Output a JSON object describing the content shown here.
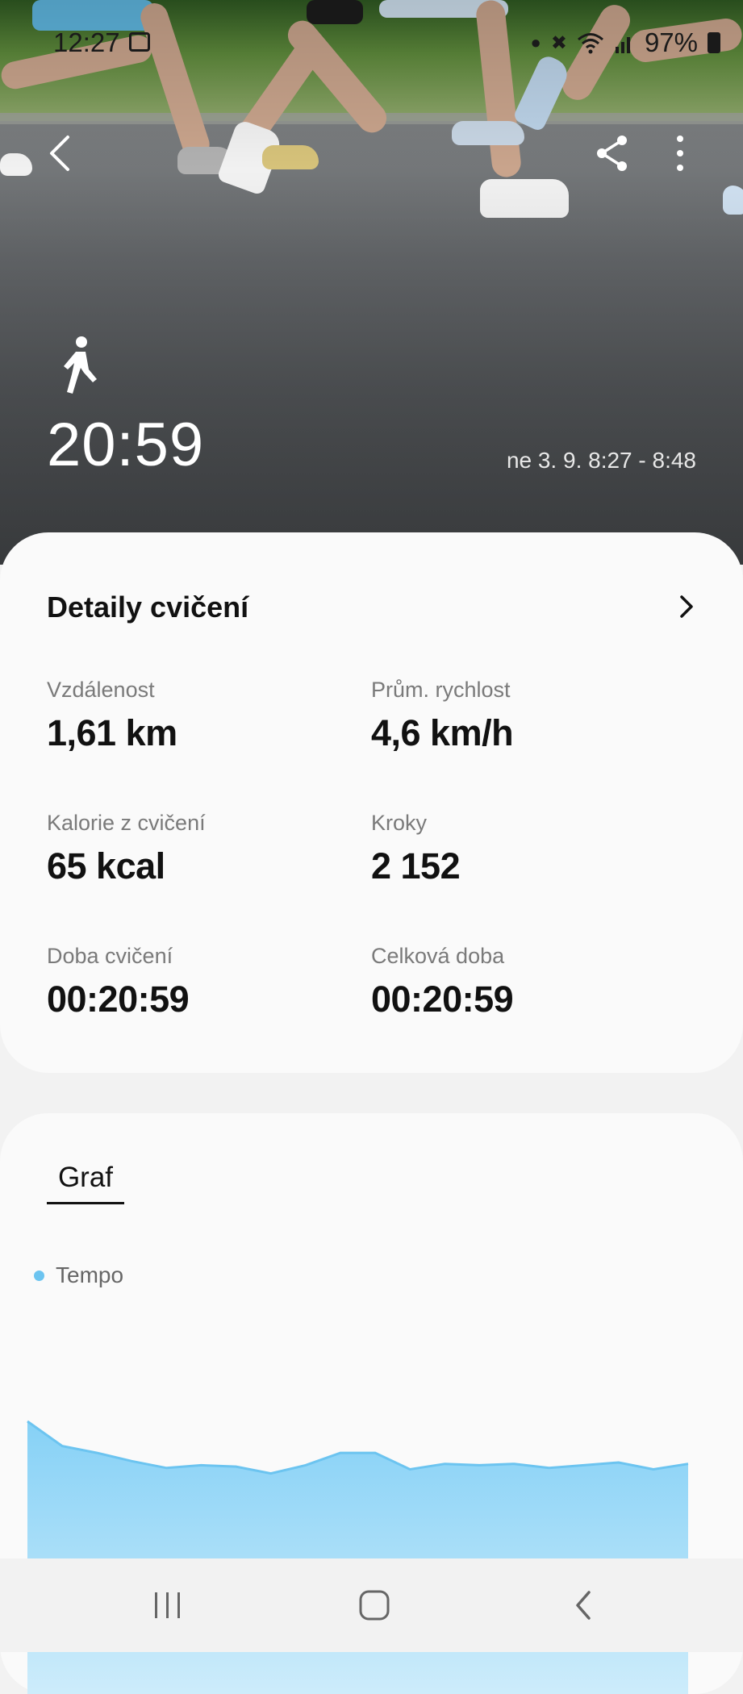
{
  "status_bar": {
    "time": "12:27",
    "battery": "97%"
  },
  "header": {
    "activity_icon": "walking-icon",
    "duration": "20:59",
    "date_range": "ne 3. 9. 8:27 - 8:48"
  },
  "details": {
    "title": "Detaily cvičení",
    "metrics": [
      {
        "label": "Vzdálenost",
        "value": "1,61 km"
      },
      {
        "label": "Prům. rychlost",
        "value": "4,6 km/h"
      },
      {
        "label": "Kalorie z cvičení",
        "value": "65 kcal"
      },
      {
        "label": "Kroky",
        "value": "2 152"
      },
      {
        "label": "Doba cvičení",
        "value": "00:20:59"
      },
      {
        "label": "Celková doba",
        "value": "00:20:59"
      }
    ]
  },
  "graph": {
    "tab_label": "Graf",
    "legend_label": "Tempo",
    "accent_color": "#6cc4f0"
  },
  "chart_data": {
    "type": "area",
    "series": [
      {
        "name": "Tempo",
        "values": [
          100,
          82,
          77,
          71,
          66,
          68,
          67,
          62,
          68,
          77,
          77,
          65,
          69,
          68,
          69,
          66,
          68,
          70,
          65,
          69
        ]
      }
    ]
  }
}
